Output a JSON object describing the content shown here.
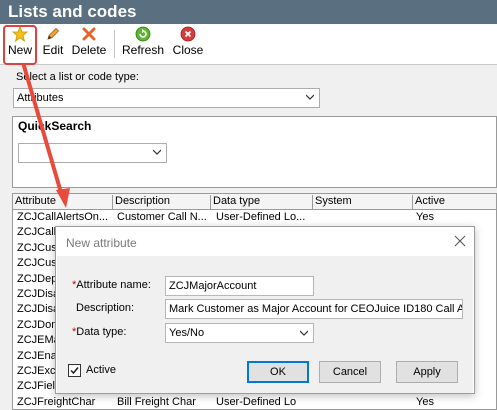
{
  "app": {
    "title": "Lists and codes"
  },
  "toolbar": {
    "new": "New",
    "edit": "Edit",
    "delete": "Delete",
    "refresh": "Refresh",
    "close": "Close"
  },
  "selector": {
    "label": "Select a list or code type:",
    "value": "Attributes"
  },
  "quicksearch": {
    "title": "QuickSearch",
    "value": ""
  },
  "grid": {
    "columns": [
      "Attribute",
      "Description",
      "Data type",
      "System",
      "Active"
    ],
    "rows": [
      [
        "ZCJCallAlertsOn...",
        "Customer Call N...",
        "User-Defined Lo...",
        "",
        "Yes"
      ],
      [
        "ZCJCallB",
        "",
        "",
        "",
        ""
      ],
      [
        "ZCJCust",
        "",
        "",
        "",
        ""
      ],
      [
        "ZCJCust",
        "",
        "",
        "",
        ""
      ],
      [
        "ZCJDepE",
        "",
        "",
        "",
        ""
      ],
      [
        "ZCJDisab",
        "",
        "",
        "",
        ""
      ],
      [
        "ZCJDisab",
        "",
        "",
        "",
        ""
      ],
      [
        "ZCJDoma",
        "",
        "",
        "",
        ""
      ],
      [
        "ZCJEMai",
        "",
        "",
        "",
        ""
      ],
      [
        "ZCJEnab",
        "",
        "",
        "",
        ""
      ],
      [
        "ZCJExclu",
        "",
        "",
        "",
        ""
      ],
      [
        "ZCJField",
        "",
        "",
        "",
        ""
      ],
      [
        "ZCJFreightChar",
        "Bill Freight Char",
        "User-Defined Lo",
        "",
        "Yes"
      ]
    ]
  },
  "dialog": {
    "title": "New attribute",
    "name_label": "Attribute name:",
    "name_value": "ZCJMajorAccount",
    "desc_label": "Description:",
    "desc_value": "Mark Customer as Major Account for CEOJuice ID180 Call Alerts",
    "type_label": "Data type:",
    "type_value": "Yes/No",
    "required_mark": "*",
    "active_label": "Active",
    "active_checked": true,
    "ok": "OK",
    "cancel": "Cancel",
    "apply": "Apply"
  },
  "colors": {
    "titlebar": "#5a6f7f",
    "highlight": "#e0403f",
    "arrow": "#e84a3c"
  }
}
